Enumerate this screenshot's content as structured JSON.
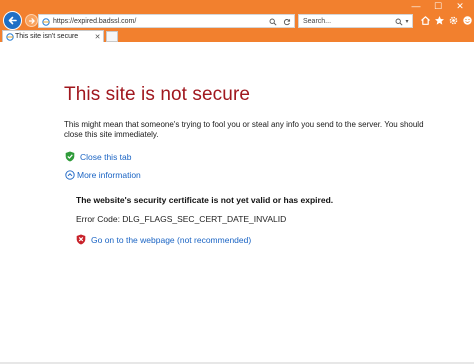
{
  "browser": {
    "address": "https://expired.badssl.com/",
    "search_placeholder": "Search...",
    "tab_title": "This site isn't secure"
  },
  "page": {
    "heading": "This site is not secure",
    "description": "This might mean that someone's trying to fool you or steal any info you send to the server. You should close this site immediately.",
    "close_tab_label": "Close this tab",
    "more_info_label": "More information",
    "details_title": "The website's security certificate is not yet valid or has expired.",
    "error_code": "Error Code: DLG_FLAGS_SEC_CERT_DATE_INVALID",
    "proceed_label": "Go on to the webpage (not recommended)"
  },
  "colors": {
    "toolbar": "#f2802e",
    "heading": "#a0171e",
    "link": "#1a64c4"
  },
  "icons": [
    "minimize-icon",
    "maximize-icon",
    "close-window-icon",
    "back-icon",
    "forward-icon",
    "page-icon",
    "search-glass-icon",
    "refresh-icon",
    "home-icon",
    "favorites-star-icon",
    "settings-gear-icon",
    "smiley-icon",
    "green-shield-icon",
    "chevron-circle-icon",
    "red-shield-icon"
  ]
}
